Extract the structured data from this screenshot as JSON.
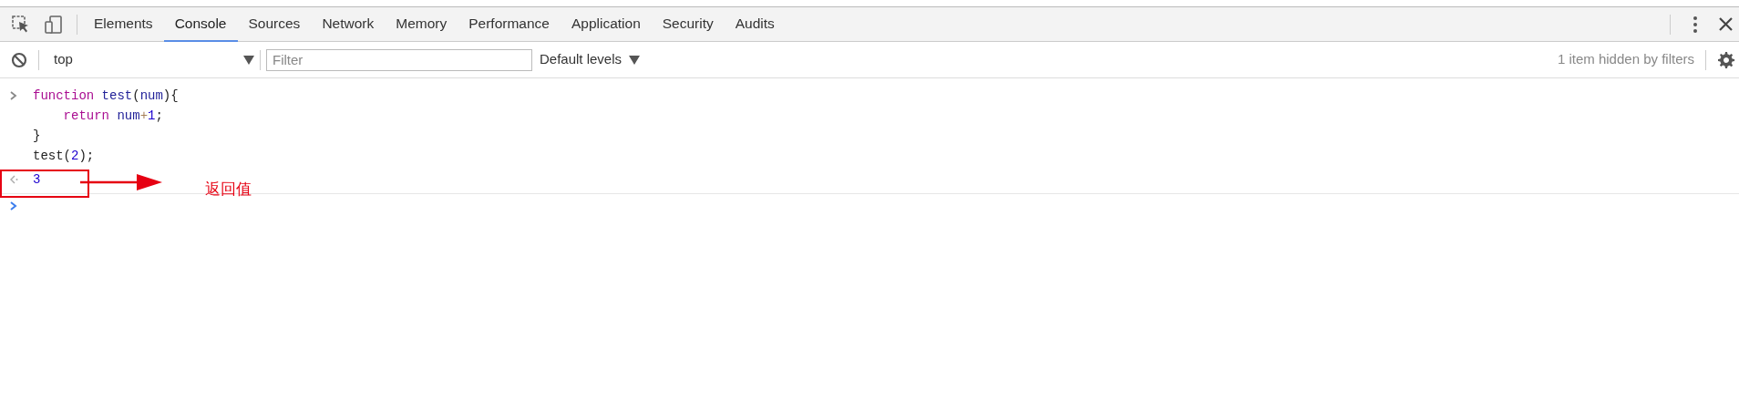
{
  "tabs": [
    {
      "label": "Elements",
      "selected": false
    },
    {
      "label": "Console",
      "selected": true
    },
    {
      "label": "Sources",
      "selected": false
    },
    {
      "label": "Network",
      "selected": false
    },
    {
      "label": "Memory",
      "selected": false
    },
    {
      "label": "Performance",
      "selected": false
    },
    {
      "label": "Application",
      "selected": false
    },
    {
      "label": "Security",
      "selected": false
    },
    {
      "label": "Audits",
      "selected": false
    }
  ],
  "toolbar": {
    "context": "top",
    "filter_placeholder": "Filter",
    "levels": "Default levels",
    "hidden_note": "1 item hidden by filters"
  },
  "console": {
    "input_lines": [
      {
        "indented": false,
        "tokens": [
          {
            "text": "function",
            "kind": "keyword"
          },
          {
            "text": "test",
            "kind": "name",
            "spaced": true
          },
          {
            "text": "(",
            "kind": "plain"
          },
          {
            "text": "num",
            "kind": "name"
          },
          {
            "text": "){",
            "kind": "plain"
          }
        ]
      },
      {
        "indented": true,
        "tokens": [
          {
            "text": "return",
            "kind": "keyword"
          },
          {
            "text": "num",
            "kind": "name",
            "spaced": true
          },
          {
            "text": "+",
            "kind": "operator"
          },
          {
            "text": "1",
            "kind": "number"
          },
          {
            "text": ";",
            "kind": "plain"
          }
        ]
      },
      {
        "indented": false,
        "tokens": [
          {
            "text": "}",
            "kind": "plain"
          }
        ]
      },
      {
        "indented": false,
        "tokens": [
          {
            "text": "test(",
            "kind": "plain"
          },
          {
            "text": "2",
            "kind": "number"
          },
          {
            "text": ");",
            "kind": "plain"
          }
        ]
      }
    ],
    "result": "3"
  },
  "annotation": {
    "label": "返回值"
  }
}
